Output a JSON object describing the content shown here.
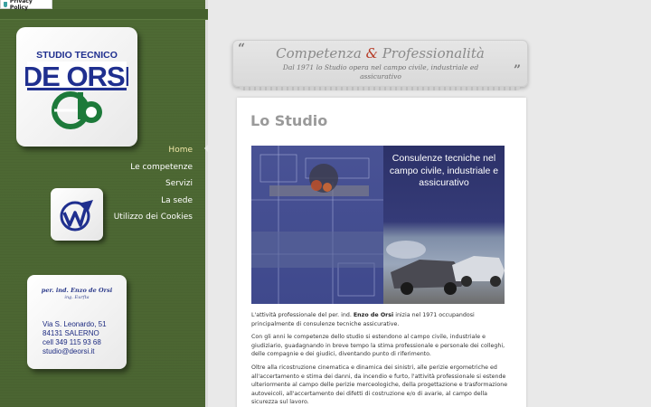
{
  "privacy": {
    "label": "Privacy Policy"
  },
  "logo": {
    "line1": "STUDIO TECNICO",
    "line2": "DE ORSI"
  },
  "nav": {
    "items": [
      {
        "label": "Home",
        "active": true
      },
      {
        "label": "Le competenze",
        "active": false
      },
      {
        "label": "Servizi",
        "active": false
      },
      {
        "label": "La sede",
        "active": false
      },
      {
        "label": "Utilizzo dei Cookies",
        "active": false
      }
    ]
  },
  "card": {
    "name": "per. ind. Enzo de Orsi",
    "signature": "ing. Eurfta",
    "address": "Via S. Leonardo, 51",
    "city": "84131 SALERNO",
    "phone": "cell  349 115 93 68",
    "email": "studio@deorsi.it"
  },
  "banner": {
    "title_part1": "Competenza ",
    "title_amp": "&",
    "title_part2": " Professionalità",
    "subtitle": "Dal 1971 lo Studio opera nel campo civile, industriale ed assicurativo"
  },
  "content": {
    "title": "Lo Studio",
    "hero_text": "Consulenze tecniche nel campo civile, industriale e assicurativo",
    "p1_pre": "L'attività professionale del per. ind. ",
    "p1_bold": "Enzo de Orsi",
    "p1_post": " inizia nel 1971 occupandosi principalmente di consulenze tecniche assicurative.",
    "p2": "Con gli anni le competenze dello studio si estendono al campo civile,  industriale e giudiziario, guadagnando in breve tempo la stima professionale e personale dei colleghi, delle compagnie e dei giudici, diventando punto di riferimento.",
    "p3": "Oltre alla ricostruzione cinematica e dinamica dei sinistri, alle perizie ergometriche ed all'accertamento e stima dei danni, da incendio e furto, l'attività professionale si estende ulteriormente al campo delle perizie merceologiche, della progettazione e trasformazione autoveicoli, all'accertamento dei difetti di costruzione e/o di avarie, al campo della sicurezza sul lavoro."
  },
  "colors": {
    "sidebar": "#4f6a35",
    "nav_active": "#f1e7a8",
    "logo_blue": "#1f2f8f",
    "logo_green": "#1d7a3a",
    "accent_amp": "#b63a25"
  }
}
